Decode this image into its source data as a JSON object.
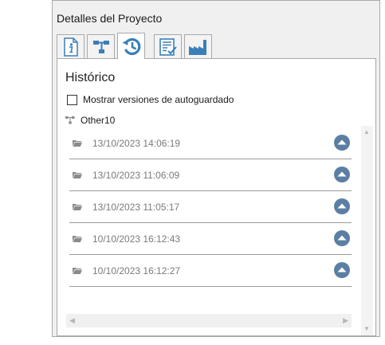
{
  "panel": {
    "title": "Detalles del Proyecto"
  },
  "tabs": [
    {
      "icon": "info-icon"
    },
    {
      "icon": "hierarchy-icon"
    },
    {
      "icon": "history-icon",
      "active": true
    },
    {
      "icon": "checklist-icon"
    },
    {
      "icon": "factory-icon"
    }
  ],
  "history": {
    "title": "Histórico",
    "autosave_checkbox": {
      "label": "Mostrar versiones de autoguardado",
      "checked": false
    },
    "project": {
      "name": "Other10",
      "icon": "hierarchy-icon"
    },
    "versions": [
      {
        "date": "13/10/2023 14:06:19"
      },
      {
        "date": "13/10/2023 11:06:09"
      },
      {
        "date": "13/10/2023 11:05:17"
      },
      {
        "date": "10/10/2023 16:12:43"
      },
      {
        "date": "10/10/2023 16:12:27"
      }
    ]
  },
  "colors": {
    "accent": "#3a7fb8",
    "restore": "#5b7fa3",
    "folder": "#8a8a8a",
    "date_text": "#7a7a7a"
  }
}
